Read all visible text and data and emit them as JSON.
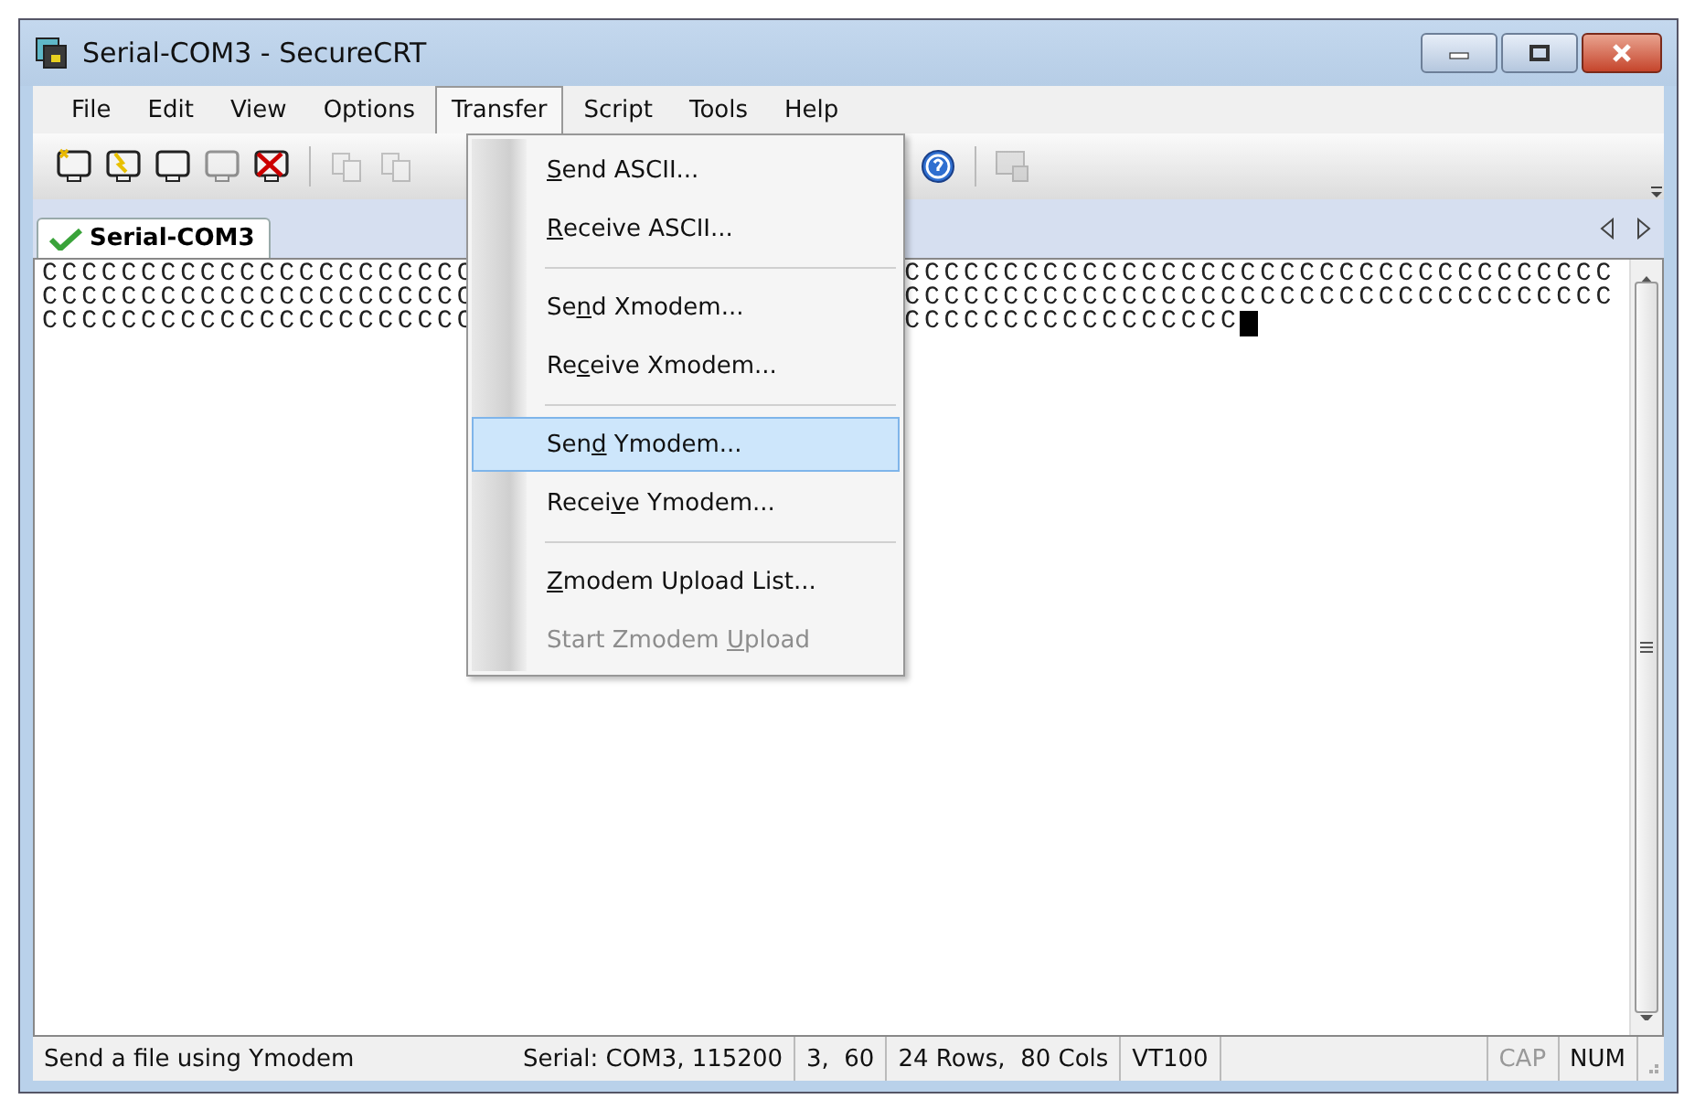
{
  "window": {
    "title": "Serial-COM3 - SecureCRT"
  },
  "menu_bar": [
    {
      "label": "File",
      "selected": false
    },
    {
      "label": "Edit",
      "selected": false
    },
    {
      "label": "View",
      "selected": false
    },
    {
      "label": "Options",
      "selected": false
    },
    {
      "label": "Transfer",
      "selected": true
    },
    {
      "label": "Script",
      "selected": false
    },
    {
      "label": "Tools",
      "selected": false
    },
    {
      "label": "Help",
      "selected": false
    }
  ],
  "toolbar": [
    {
      "kind": "new",
      "disabled": false
    },
    {
      "kind": "connect",
      "disabled": false
    },
    {
      "kind": "folder",
      "disabled": false
    },
    {
      "kind": "reconnect",
      "disabled": true
    },
    {
      "kind": "disconnect",
      "disabled": false
    },
    {
      "kind": "sep"
    },
    {
      "kind": "copy",
      "disabled": true
    },
    {
      "kind": "paste",
      "disabled": true
    },
    {
      "kind": "gap"
    },
    {
      "kind": "sep"
    },
    {
      "kind": "help",
      "disabled": false
    },
    {
      "kind": "sep"
    },
    {
      "kind": "lock",
      "disabled": true
    }
  ],
  "tabs": [
    {
      "label": "Serial-COM3",
      "selected": true,
      "connected": true
    }
  ],
  "terminal": {
    "lines": [
      {
        "left": "CCCCCCCCCCCCCCCCCCCCCC",
        "right": "CCCCCCCCCCCCCCCCCCCCCCCCCCCCCCCCCCCC"
      },
      {
        "left": "CCCCCCCCCCCCCCCCCCCCCC",
        "right": "CCCCCCCCCCCCCCCCCCCCCCCCCCCCCCCCCCCC"
      },
      {
        "left": "CCCCCCCCCCCCCCCCCCCCCC",
        "right": "CCCCCCCCCCCCCCCCC",
        "cursor": true
      }
    ]
  },
  "transfer_menu": [
    {
      "kind": "item",
      "key": "S",
      "after": "end ASCII...",
      "selected": false,
      "disabled": false
    },
    {
      "kind": "item",
      "key": "R",
      "after": "eceive ASCII...",
      "selected": false,
      "disabled": false
    },
    {
      "kind": "separator"
    },
    {
      "kind": "item",
      "before": "Se",
      "key": "n",
      "after": "d Xmodem...",
      "selected": false,
      "disabled": false
    },
    {
      "kind": "item",
      "before": "Re",
      "key": "c",
      "after": "eive Xmodem...",
      "selected": false,
      "disabled": false
    },
    {
      "kind": "separator"
    },
    {
      "kind": "item",
      "before": "Sen",
      "key": "d",
      "after": " Ymodem...",
      "selected": true,
      "disabled": false
    },
    {
      "kind": "item",
      "before": "Recei",
      "key": "v",
      "after": "e Ymodem...",
      "selected": false,
      "disabled": false
    },
    {
      "kind": "separator"
    },
    {
      "kind": "item",
      "key": "Z",
      "after": "modem Upload List...",
      "selected": false,
      "disabled": false
    },
    {
      "kind": "item",
      "before": "Start Zmodem ",
      "key": "U",
      "after": "pload",
      "selected": false,
      "disabled": true
    }
  ],
  "status_bar": {
    "message": "Send a file using Ymodem",
    "panes": [
      "Serial: COM3, 115200",
      "3,  60",
      "24 Rows,  80 Cols",
      "VT100"
    ],
    "indicators": [
      {
        "label": "CAP",
        "active": false
      },
      {
        "label": "NUM",
        "active": true
      }
    ]
  }
}
